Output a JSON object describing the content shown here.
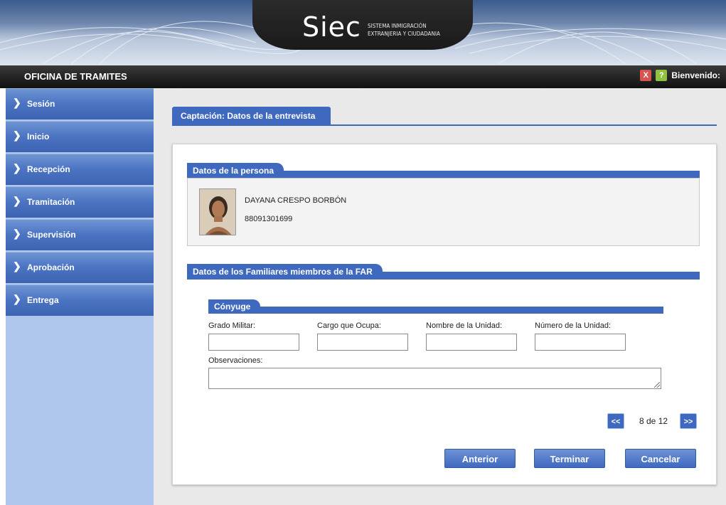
{
  "header": {
    "logo_text": "Siec",
    "logo_subtitle_line1": "SISTEMA INMIGRACIÓN",
    "logo_subtitle_line2": "EXTRANJERIA Y CIUDADANIA",
    "office_title": "OFICINA DE TRAMITES",
    "welcome_text": "Bienvenido:",
    "close_icon_glyph": "X",
    "help_icon_glyph": "?"
  },
  "sidebar": {
    "items": [
      {
        "label": "Sesión"
      },
      {
        "label": "Inicio"
      },
      {
        "label": "Recepción"
      },
      {
        "label": "Tramitación"
      },
      {
        "label": "Supervisión"
      },
      {
        "label": "Aprobación"
      },
      {
        "label": "Entrega"
      }
    ]
  },
  "main": {
    "tab_title": "Captación: Datos de la entrevista",
    "person_section": {
      "title": "Datos de la persona",
      "name": "DAYANA CRESPO BORBÓN",
      "id_number": "88091301699"
    },
    "family_section": {
      "title": "Datos de los Familiares miembros de la FAR",
      "spouse": {
        "title": "Cónyuge",
        "fields": {
          "grado_label": "Grado Militar:",
          "grado_value": "",
          "cargo_label": "Cargo que Ocupa:",
          "cargo_value": "",
          "unidad_label": "Nombre de la Unidad:",
          "unidad_value": "",
          "numero_label": "Número de la Unidad:",
          "numero_value": "",
          "observaciones_label": "Observaciones:",
          "observaciones_value": ""
        }
      }
    },
    "pager": {
      "prev_label": "<<",
      "next_label": ">>",
      "status": "8 de 12"
    },
    "buttons": {
      "anterior": "Anterior",
      "terminar": "Terminar",
      "cancelar": "Cancelar"
    }
  },
  "colors": {
    "accent_blue": "#3f69bf",
    "sidebar_bg": "#afc7ee",
    "topbar_bg": "#111111"
  }
}
